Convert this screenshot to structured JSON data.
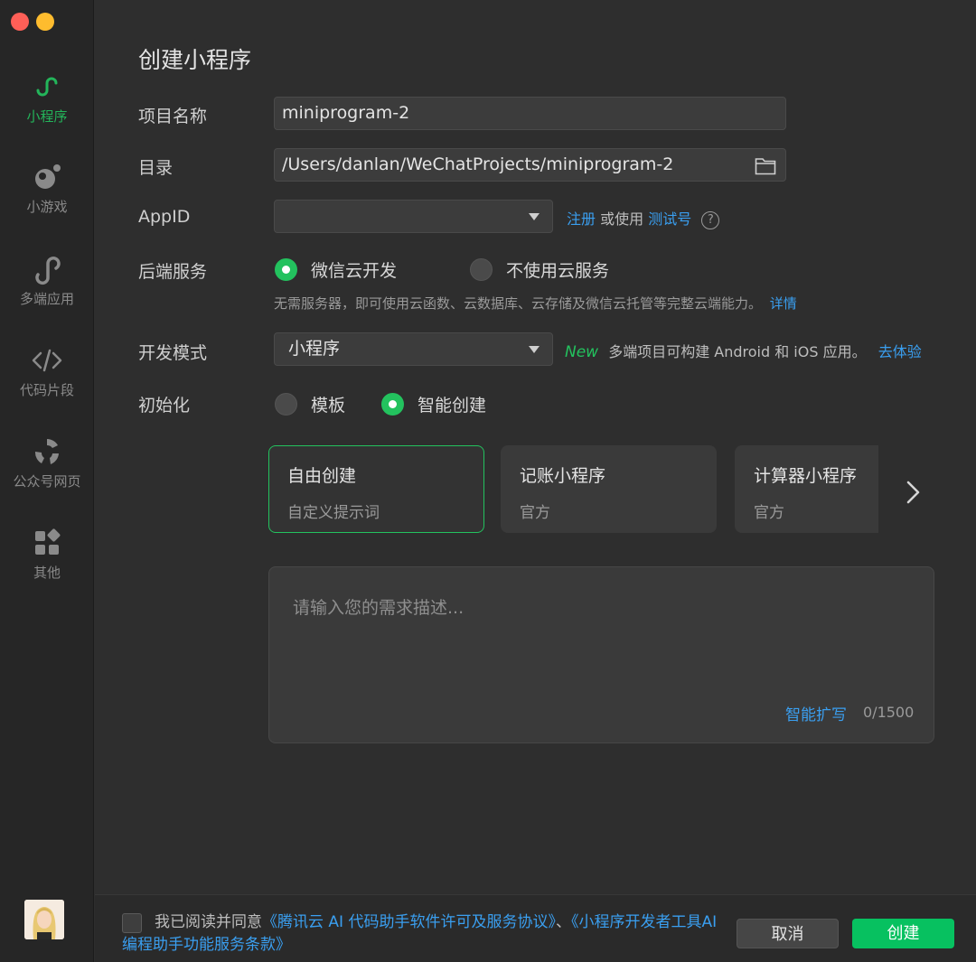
{
  "sidebar": {
    "items": [
      {
        "label": "小程序",
        "icon": "miniprogram-icon"
      },
      {
        "label": "小游戏",
        "icon": "minigame-icon"
      },
      {
        "label": "多端应用",
        "icon": "multiplatform-icon"
      },
      {
        "label": "代码片段",
        "icon": "code-snippet-icon"
      },
      {
        "label": "公众号网页",
        "icon": "official-account-icon"
      },
      {
        "label": "其他",
        "icon": "apps-grid-icon"
      }
    ]
  },
  "page": {
    "title": "创建小程序"
  },
  "form": {
    "name_label": "项目名称",
    "name_value": "miniprogram-2",
    "dir_label": "目录",
    "dir_value": "/Users/danlan/WeChatProjects/miniprogram-2",
    "appid_label": "AppID",
    "appid_register": "注册",
    "appid_or_use": "或使用",
    "appid_test": "测试号",
    "backend_label": "后端服务",
    "backend_opt_cloud": "微信云开发",
    "backend_opt_none": "不使用云服务",
    "backend_desc": "无需服务器，即可使用云函数、云数据库、云存储及微信云托管等完整云端能力。",
    "backend_detail": "详情",
    "devmode_label": "开发模式",
    "devmode_value": "小程序",
    "devmode_new": "New",
    "devmode_desc": "多端项目可构建 Android 和 iOS 应用。",
    "devmode_try": "去体验",
    "init_label": "初始化",
    "init_opt_template": "模板",
    "init_opt_ai": "智能创建"
  },
  "cards": [
    {
      "title": "自由创建",
      "sub": "自定义提示词"
    },
    {
      "title": "记账小程序",
      "sub": "官方"
    },
    {
      "title": "计算器小程序",
      "sub": "官方"
    }
  ],
  "prompt": {
    "placeholder": "请输入您的需求描述...",
    "expand": "智能扩写",
    "count": "0/1500"
  },
  "footer": {
    "agree_prefix": "我已阅读并同意",
    "agree_link1": "《腾讯云 AI 代码助手软件许可及服务协议》",
    "agree_sep": "、",
    "agree_link2": "《小程序开发者工具AI编程助手功能服务条款》",
    "cancel": "取消",
    "create": "创建"
  },
  "colors": {
    "accent": "#07c160",
    "link": "#3a9ff0"
  }
}
